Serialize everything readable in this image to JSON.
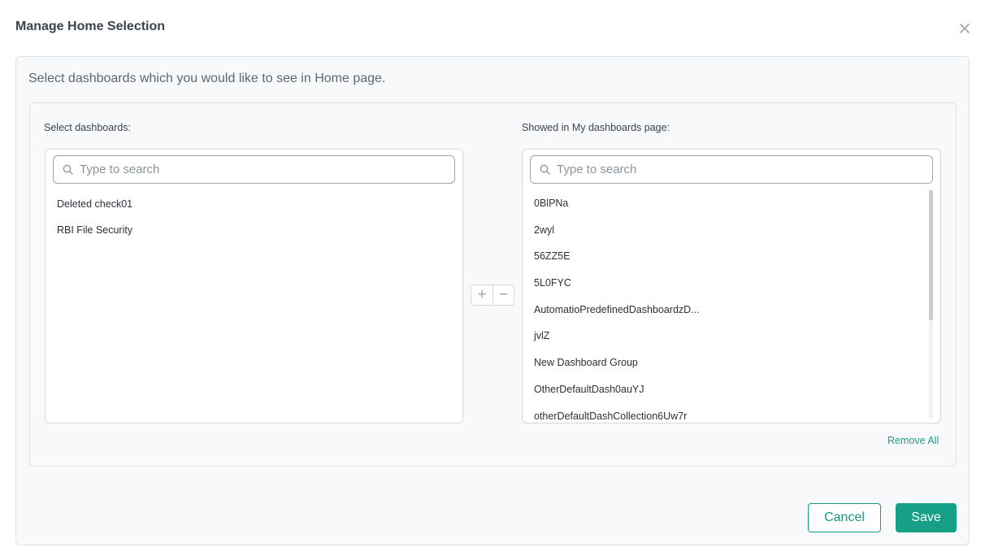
{
  "dialog": {
    "title": "Manage Home Selection",
    "close_icon": "close-icon"
  },
  "intro": "Select dashboards which you would like to see in Home page.",
  "left": {
    "label": "Select dashboards:",
    "search_placeholder": "Type to search",
    "items": [
      "Deleted check01",
      "RBI File Security"
    ]
  },
  "right": {
    "label": "Showed in My dashboards page:",
    "search_placeholder": "Type to search",
    "items": [
      "0BlPNa",
      "2wyl",
      "56ZZ5E",
      "5L0FYC",
      "AutomatioPredefinedDashboardzD...",
      "jvlZ",
      "New Dashboard Group",
      "OtherDefaultDash0auYJ",
      "otherDefaultDashCollection6Uw7r"
    ]
  },
  "mover": {
    "add_label": "+",
    "remove_label": "−"
  },
  "remove_all_label": "Remove All",
  "buttons": {
    "cancel": "Cancel",
    "save": "Save"
  },
  "colors": {
    "accent": "#15a087",
    "panel_bg": "#f8f9fa",
    "border": "#dfe2e6"
  }
}
